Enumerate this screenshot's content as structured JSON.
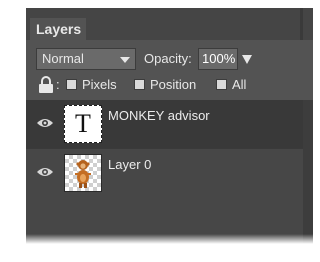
{
  "panel": {
    "tab_label": "Layers",
    "blend_mode": "Normal",
    "opacity_label": "Opacity:",
    "opacity_value": "100%",
    "lock_colon": ":",
    "lock_options": [
      {
        "label": "Pixels",
        "checked": false
      },
      {
        "label": "Position",
        "checked": false
      },
      {
        "label": "All",
        "checked": false
      }
    ]
  },
  "layers": [
    {
      "name": "MONKEY advisor",
      "type": "text",
      "thumb_glyph": "T",
      "visible": true,
      "selected": true
    },
    {
      "name": "Layer 0",
      "type": "image",
      "visible": true,
      "selected": false
    }
  ],
  "icons": {
    "lock": "lock-icon",
    "visibility": "eye-icon",
    "dropdown": "chevron-down-icon",
    "opacity_dropdown": "triangle-down-icon"
  },
  "colors": {
    "panel_bg": "#535353",
    "tabbar_bg": "#454545",
    "selected_layer_bg": "#393939",
    "text": "#e8e8e8"
  }
}
